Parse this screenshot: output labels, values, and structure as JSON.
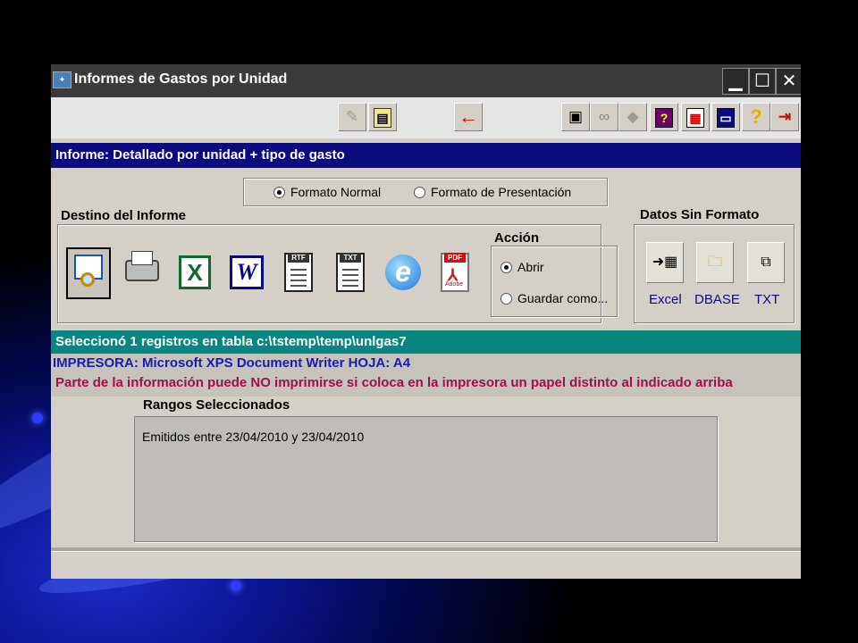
{
  "window": {
    "title": "Informes de Gastos por Unidad",
    "controls": [
      "minimize",
      "maximize",
      "close"
    ]
  },
  "toolbar": {
    "icons": [
      "disabled-edit-icon",
      "print-icon",
      "back-arrow-icon",
      "export-icon",
      "search-binoculars-icon",
      "disabled-icon",
      "help-question-icon",
      "calendar-icon",
      "calculator-icon",
      "help-icon",
      "exit-icon"
    ]
  },
  "informe": {
    "label": "Informe: Detallado por unidad + tipo de gasto"
  },
  "formato": {
    "normal": "Formato Normal",
    "presentacion": "Formato de Presentación",
    "selected": "Formato Normal"
  },
  "destino": {
    "label": "Destino del Informe",
    "options": [
      "preview",
      "printer",
      "excel",
      "word",
      "rtf",
      "txt",
      "internet-explorer",
      "pdf"
    ],
    "selected": "preview",
    "icon_text": {
      "excel": "X",
      "word": "W",
      "rtf": "RTF",
      "txt": "TXT",
      "ie": "e",
      "pdf": "PDF",
      "adobe": "Adobe"
    }
  },
  "accion": {
    "label": "Acción",
    "abrir": "Abrir",
    "guardar": "Guardar como...",
    "selected": "Abrir"
  },
  "datos_sin_formato": {
    "label": "Datos Sin Formato",
    "excel": "Excel",
    "dbase": "DBASE",
    "txt": "TXT"
  },
  "status": {
    "selection": "Seleccionó 1 registros en tabla c:\\tstemp\\temp\\unlgas7",
    "printer": "IMPRESORA: Microsoft XPS Document Writer HOJA: A4",
    "warning": "Parte de la información puede NO imprimirse si coloca en la impresora un papel distinto al indicado arriba"
  },
  "rangos": {
    "label": "Rangos Seleccionados",
    "text": "Emitidos entre 23/04/2010 y 23/04/2010"
  },
  "colors": {
    "title_bar": "#3b3b3b",
    "informe_bar": "#0b0b80",
    "status_bar": "#0a8680",
    "warning_text": "#a0104a",
    "printer_text": "#1b1bb0"
  }
}
